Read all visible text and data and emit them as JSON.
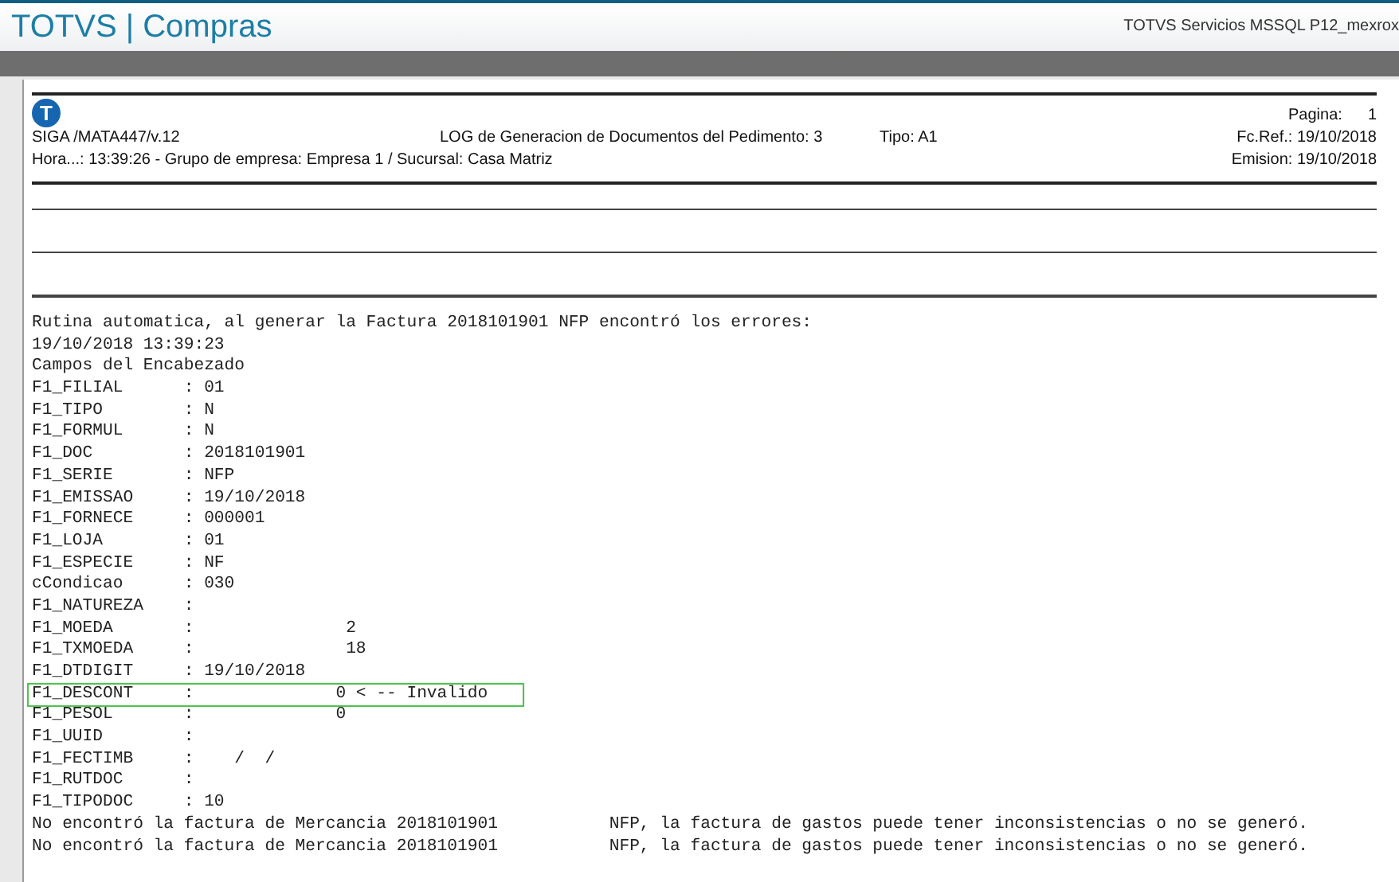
{
  "app_bar": {
    "title": "TOTVS | Compras",
    "connection": "TOTVS Servicios MSSQL P12_mexrox"
  },
  "report": {
    "logo_letter": "T",
    "page_label": "Pagina:",
    "page_number": "1",
    "program": "SIGA /MATA447/v.12",
    "heading": "LOG  de Generacion de Documentos del Pedimento: 3",
    "type": "Tipo: A1",
    "ref_date": "Fc.Ref.: 19/10/2018",
    "time_company": "Hora...: 13:39:26 - Grupo de empresa: Empresa 1 / Sucursal: Casa Matriz",
    "issue_date": "Emision: 19/10/2018",
    "log_lines": [
      {
        "text": "Rutina automatica, al generar la Factura 2018101901 NFP encontró los errores:",
        "highlighted": false
      },
      {
        "text": "19/10/2018 13:39:23",
        "highlighted": false
      },
      {
        "text": "Campos del Encabezado",
        "highlighted": false
      },
      {
        "text": "F1_FILIAL      : 01",
        "highlighted": false
      },
      {
        "text": "F1_TIPO        : N",
        "highlighted": false
      },
      {
        "text": "F1_FORMUL      : N",
        "highlighted": false
      },
      {
        "text": "F1_DOC         : 2018101901",
        "highlighted": false
      },
      {
        "text": "F1_SERIE       : NFP",
        "highlighted": false
      },
      {
        "text": "F1_EMISSAO     : 19/10/2018",
        "highlighted": false
      },
      {
        "text": "F1_FORNECE     : 000001",
        "highlighted": false
      },
      {
        "text": "F1_LOJA        : 01",
        "highlighted": false
      },
      {
        "text": "F1_ESPECIE     : NF",
        "highlighted": false
      },
      {
        "text": "cCondicao      : 030",
        "highlighted": false
      },
      {
        "text": "F1_NATUREZA    :",
        "highlighted": false
      },
      {
        "text": "F1_MOEDA       :               2",
        "highlighted": false
      },
      {
        "text": "F1_TXMOEDA     :               18",
        "highlighted": false
      },
      {
        "text": "F1_DTDIGIT     : 19/10/2018",
        "highlighted": false
      },
      {
        "text": "F1_DESCONT     :              0 < -- Invalido",
        "highlighted": true
      },
      {
        "text": "F1_PESOL       :              0",
        "highlighted": false
      },
      {
        "text": "F1_UUID        :",
        "highlighted": false
      },
      {
        "text": "F1_FECTIMB     :    /  /",
        "highlighted": false
      },
      {
        "text": "F1_RUTDOC      :",
        "highlighted": false
      },
      {
        "text": "F1_TIPODOC     : 10",
        "highlighted": false
      },
      {
        "text": "No encontró la factura de Mercancia 2018101901           NFP, la factura de gastos puede tener inconsistencias o no se generó.",
        "highlighted": false
      },
      {
        "text": "No encontró la factura de Mercancia 2018101901           NFP, la factura de gastos puede tener inconsistencias o no se generó.",
        "highlighted": false
      }
    ]
  }
}
